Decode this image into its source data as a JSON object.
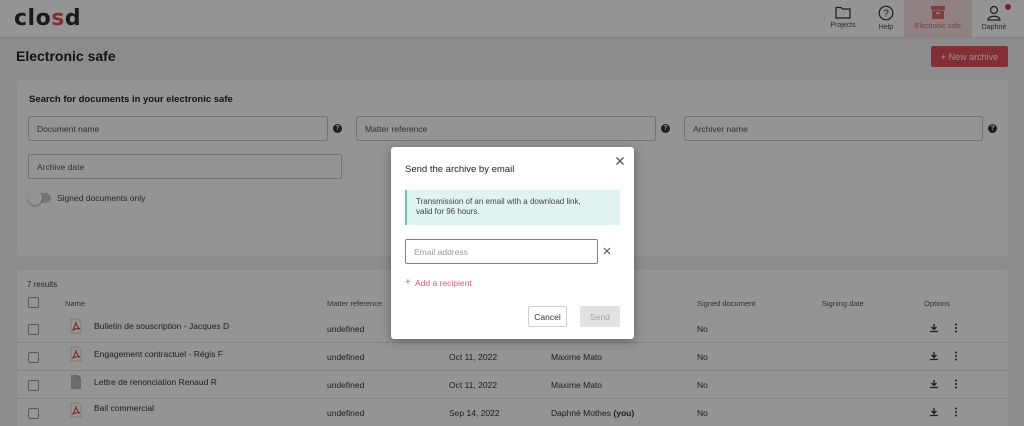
{
  "app": {
    "logo_text": "closd"
  },
  "nav": {
    "projects": "Projects",
    "help": "Help",
    "electronic_safe": "Electronic safe",
    "user": "Daphné"
  },
  "page": {
    "title": "Electronic safe",
    "new_archive": "+ New archive"
  },
  "search": {
    "title": "Search for documents in your electronic safe",
    "document_name": "Document name",
    "matter_reference": "Matter reference",
    "archiver_name": "Archiver name",
    "archive_date": "Archive date",
    "signed_only": "Signed documents only"
  },
  "results": {
    "count": "7 results",
    "columns": {
      "name": "Name",
      "matter_reference": "Matter reference",
      "signed_document": "Signed document",
      "signing_date": "Signing date",
      "options": "Options"
    },
    "rows": [
      {
        "name": "Bulletin de souscription - Jacques D",
        "matter": "undefined",
        "date": "",
        "archiver": "",
        "you": "",
        "signed": "No",
        "icon": "pdf-icon"
      },
      {
        "name": "Engagement contractuel - Régis F",
        "matter": "undefined",
        "date": "Oct 11, 2022",
        "archiver": "Maxime Mato",
        "you": "",
        "signed": "No",
        "icon": "pdf-icon"
      },
      {
        "name": "Lettre de renonciation Renaud R",
        "matter": "undefined",
        "date": "Oct 11, 2022",
        "archiver": "Maxime Mato",
        "you": "",
        "signed": "No",
        "icon": "document-icon"
      },
      {
        "name": "Bail commercial",
        "matter": "undefined",
        "date": "Sep 14, 2022",
        "archiver": "Daphné Mothes",
        "you": "(you)",
        "signed": "No",
        "icon": "pdf-icon"
      }
    ]
  },
  "modal": {
    "title": "Send the archive by email",
    "info_line1": "Transmission of an email with a download link,",
    "info_line2": "valid for 96 hours.",
    "email_placeholder": "Email address",
    "add_recipient": "Add a recipient",
    "cancel": "Cancel",
    "send": "Send"
  },
  "colors": {
    "accent": "#e0505c",
    "info_bg": "#dff4f1",
    "input_focus": "#4a90c8"
  }
}
